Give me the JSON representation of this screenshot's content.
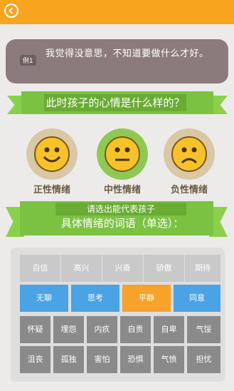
{
  "example": {
    "tag": "例1",
    "text": "我觉得没意思，不知道要做什么才好。"
  },
  "question1": "此时孩子的心情是什么样的？",
  "moods": [
    "正性情绪",
    "中性情绪",
    "负性情绪"
  ],
  "question2": {
    "line1": "请选出能代表孩子",
    "line2": "具体情绪的词语（单选）："
  },
  "words": {
    "row1": [
      "自信",
      "高兴",
      "兴奋",
      "骄傲",
      "期待"
    ],
    "row2": [
      "无聊",
      "思考",
      "平静",
      "同意"
    ],
    "row3": [
      "怀疑",
      "埋怨",
      "内疚",
      "自责",
      "自卑",
      "气馁"
    ],
    "row4": [
      "沮丧",
      "孤独",
      "害怕",
      "恐惧",
      "气愤",
      "担忧"
    ]
  }
}
